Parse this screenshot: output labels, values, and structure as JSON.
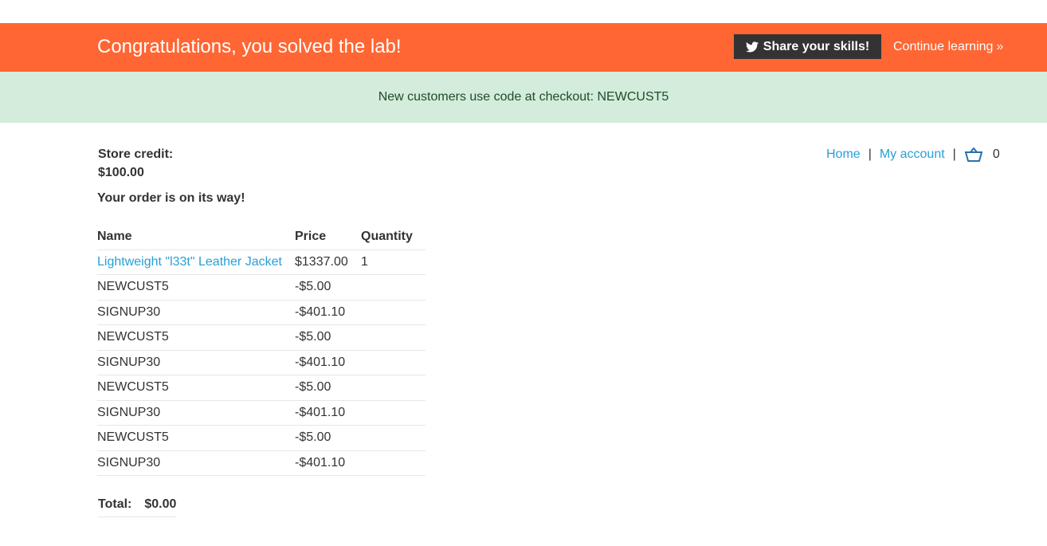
{
  "banner": {
    "title": "Congratulations, you solved the lab!",
    "share_label": "Share your skills!",
    "continue_label": "Continue learning",
    "background": "#ff6633"
  },
  "notice": {
    "text": "New customers use code at checkout: NEWCUST5",
    "background": "#d4ecdb"
  },
  "account": {
    "credit_label": "Store credit:",
    "credit_value": "$100.00",
    "order_message": "Your order is on its way!"
  },
  "nav": {
    "home": "Home",
    "separator": "|",
    "my_account": "My account",
    "cart_icon": "basket-icon",
    "cart_count": "0",
    "link_color": "#2a9fd6"
  },
  "order": {
    "headers": [
      "Name",
      "Price",
      "Quantity"
    ],
    "rows": [
      {
        "name": "Lightweight \"l33t\" Leather Jacket",
        "price": "$1337.00",
        "quantity": "1",
        "link": true
      },
      {
        "name": "NEWCUST5",
        "price": "-$5.00",
        "quantity": ""
      },
      {
        "name": "SIGNUP30",
        "price": "-$401.10",
        "quantity": ""
      },
      {
        "name": "NEWCUST5",
        "price": "-$5.00",
        "quantity": ""
      },
      {
        "name": "SIGNUP30",
        "price": "-$401.10",
        "quantity": ""
      },
      {
        "name": "NEWCUST5",
        "price": "-$5.00",
        "quantity": ""
      },
      {
        "name": "SIGNUP30",
        "price": "-$401.10",
        "quantity": ""
      },
      {
        "name": "NEWCUST5",
        "price": "-$5.00",
        "quantity": ""
      },
      {
        "name": "SIGNUP30",
        "price": "-$401.10",
        "quantity": ""
      }
    ],
    "total_label": "Total:",
    "total_value": "$0.00"
  }
}
